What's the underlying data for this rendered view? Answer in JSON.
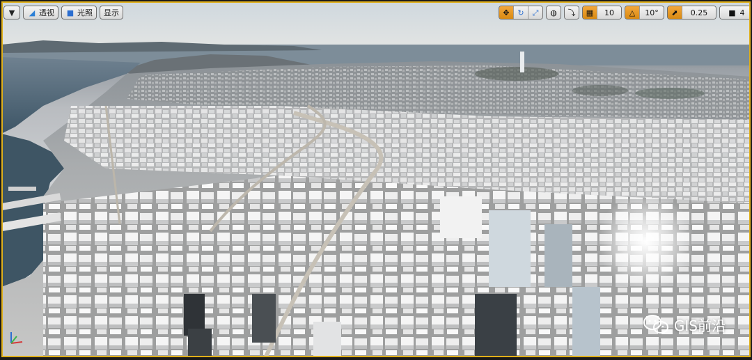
{
  "toolbar_left": {
    "menu_icon": "chevron-down-icon",
    "perspective_label": "透视",
    "lit_label": "光照",
    "show_label": "显示"
  },
  "toolbar_right": {
    "grid_snap_value": "10",
    "rotation_snap_value": "10°",
    "scale_snap_value": "0.25",
    "camera_speed_value": "4"
  },
  "watermark": {
    "text": "GIS前沿"
  },
  "colors": {
    "accent_orange": "#e89a20",
    "viewport_border": "#e0b01a"
  }
}
